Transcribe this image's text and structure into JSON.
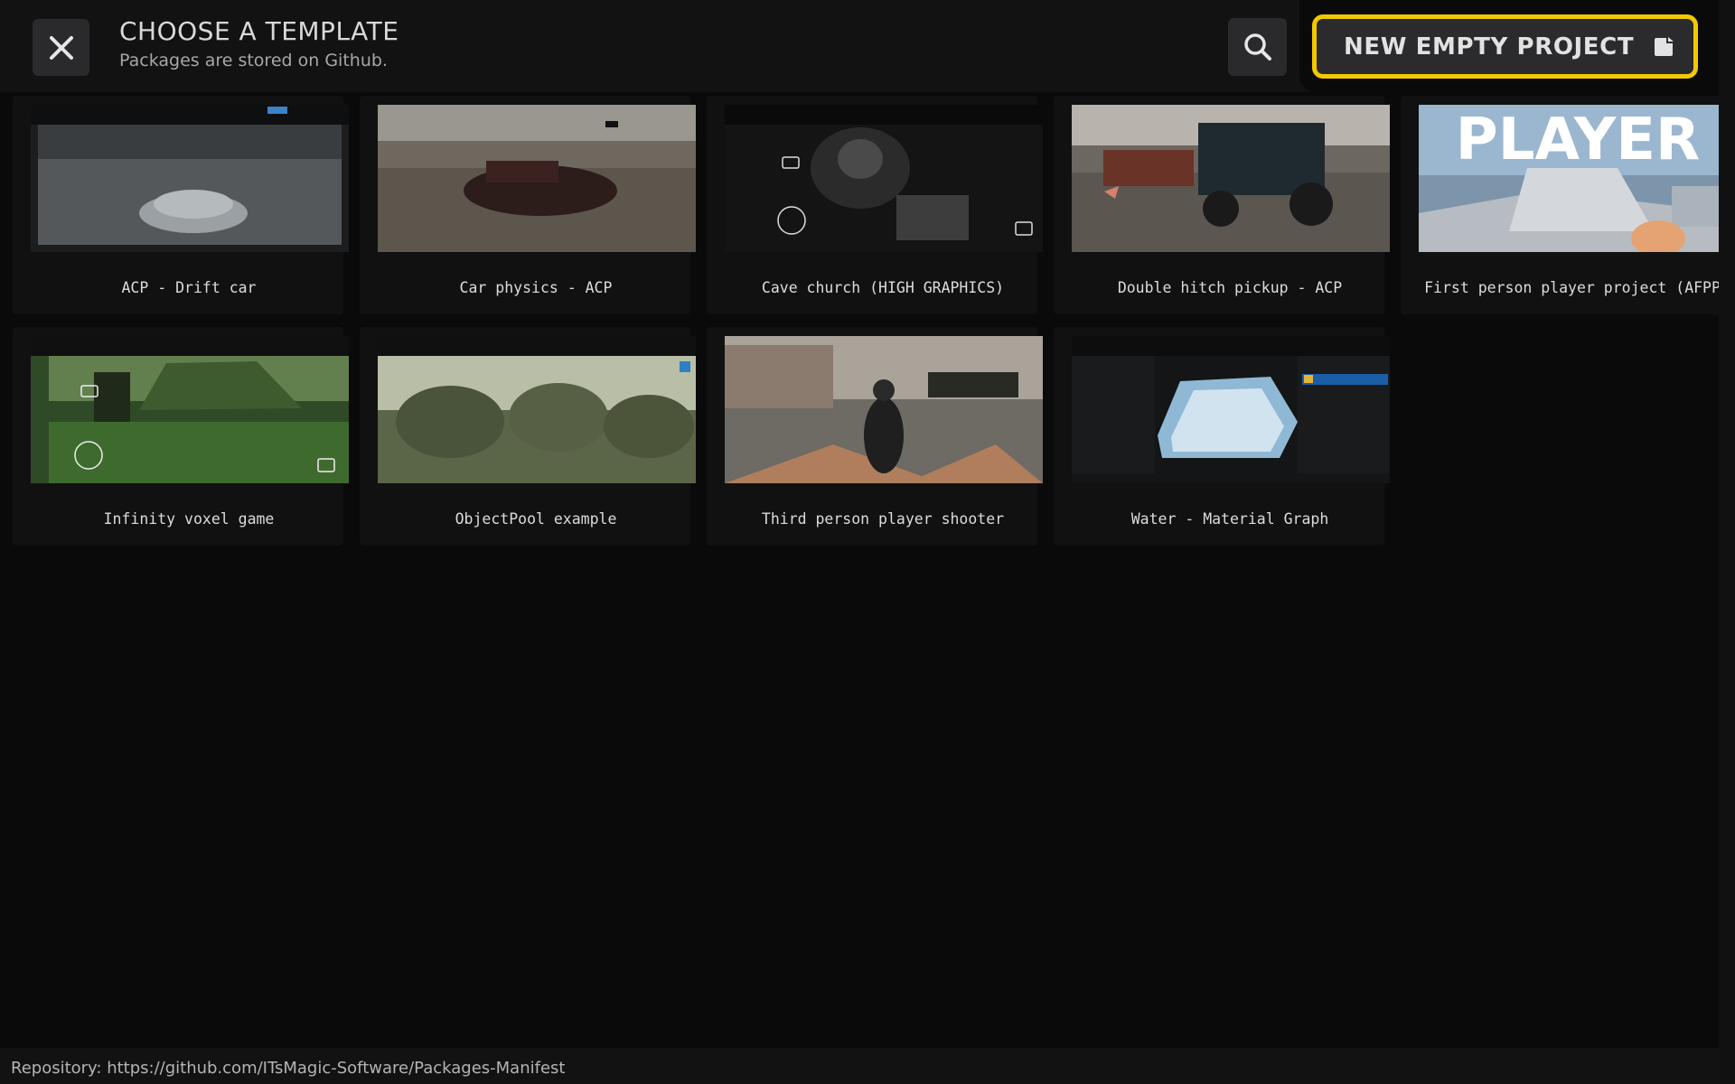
{
  "header": {
    "title": "CHOOSE A TEMPLATE",
    "subtitle": "Packages are stored on Github.",
    "new_project_label": "NEW EMPTY PROJECT"
  },
  "templates": [
    {
      "label": "ACP - Drift car"
    },
    {
      "label": "Car physics - ACP"
    },
    {
      "label": "Cave church (HIGH GRAPHICS)"
    },
    {
      "label": "Double hitch pickup - ACP"
    },
    {
      "label": "First person player project (AFPP)",
      "thumbnail_text": "PLAYER"
    },
    {
      "label": "Infinity voxel game"
    },
    {
      "label": "ObjectPool example"
    },
    {
      "label": "Third person player shooter"
    },
    {
      "label": "Water - Material Graph"
    }
  ],
  "footer": {
    "repository": "Repository: https://github.com/ITsMagic-Software/Packages-Manifest"
  },
  "colors": {
    "accent": "#f2c800",
    "background": "#0a0a0a",
    "panel": "#121213",
    "button": "#2a2a2c"
  },
  "icons": [
    "close-icon",
    "search-icon",
    "new-project-icon"
  ]
}
